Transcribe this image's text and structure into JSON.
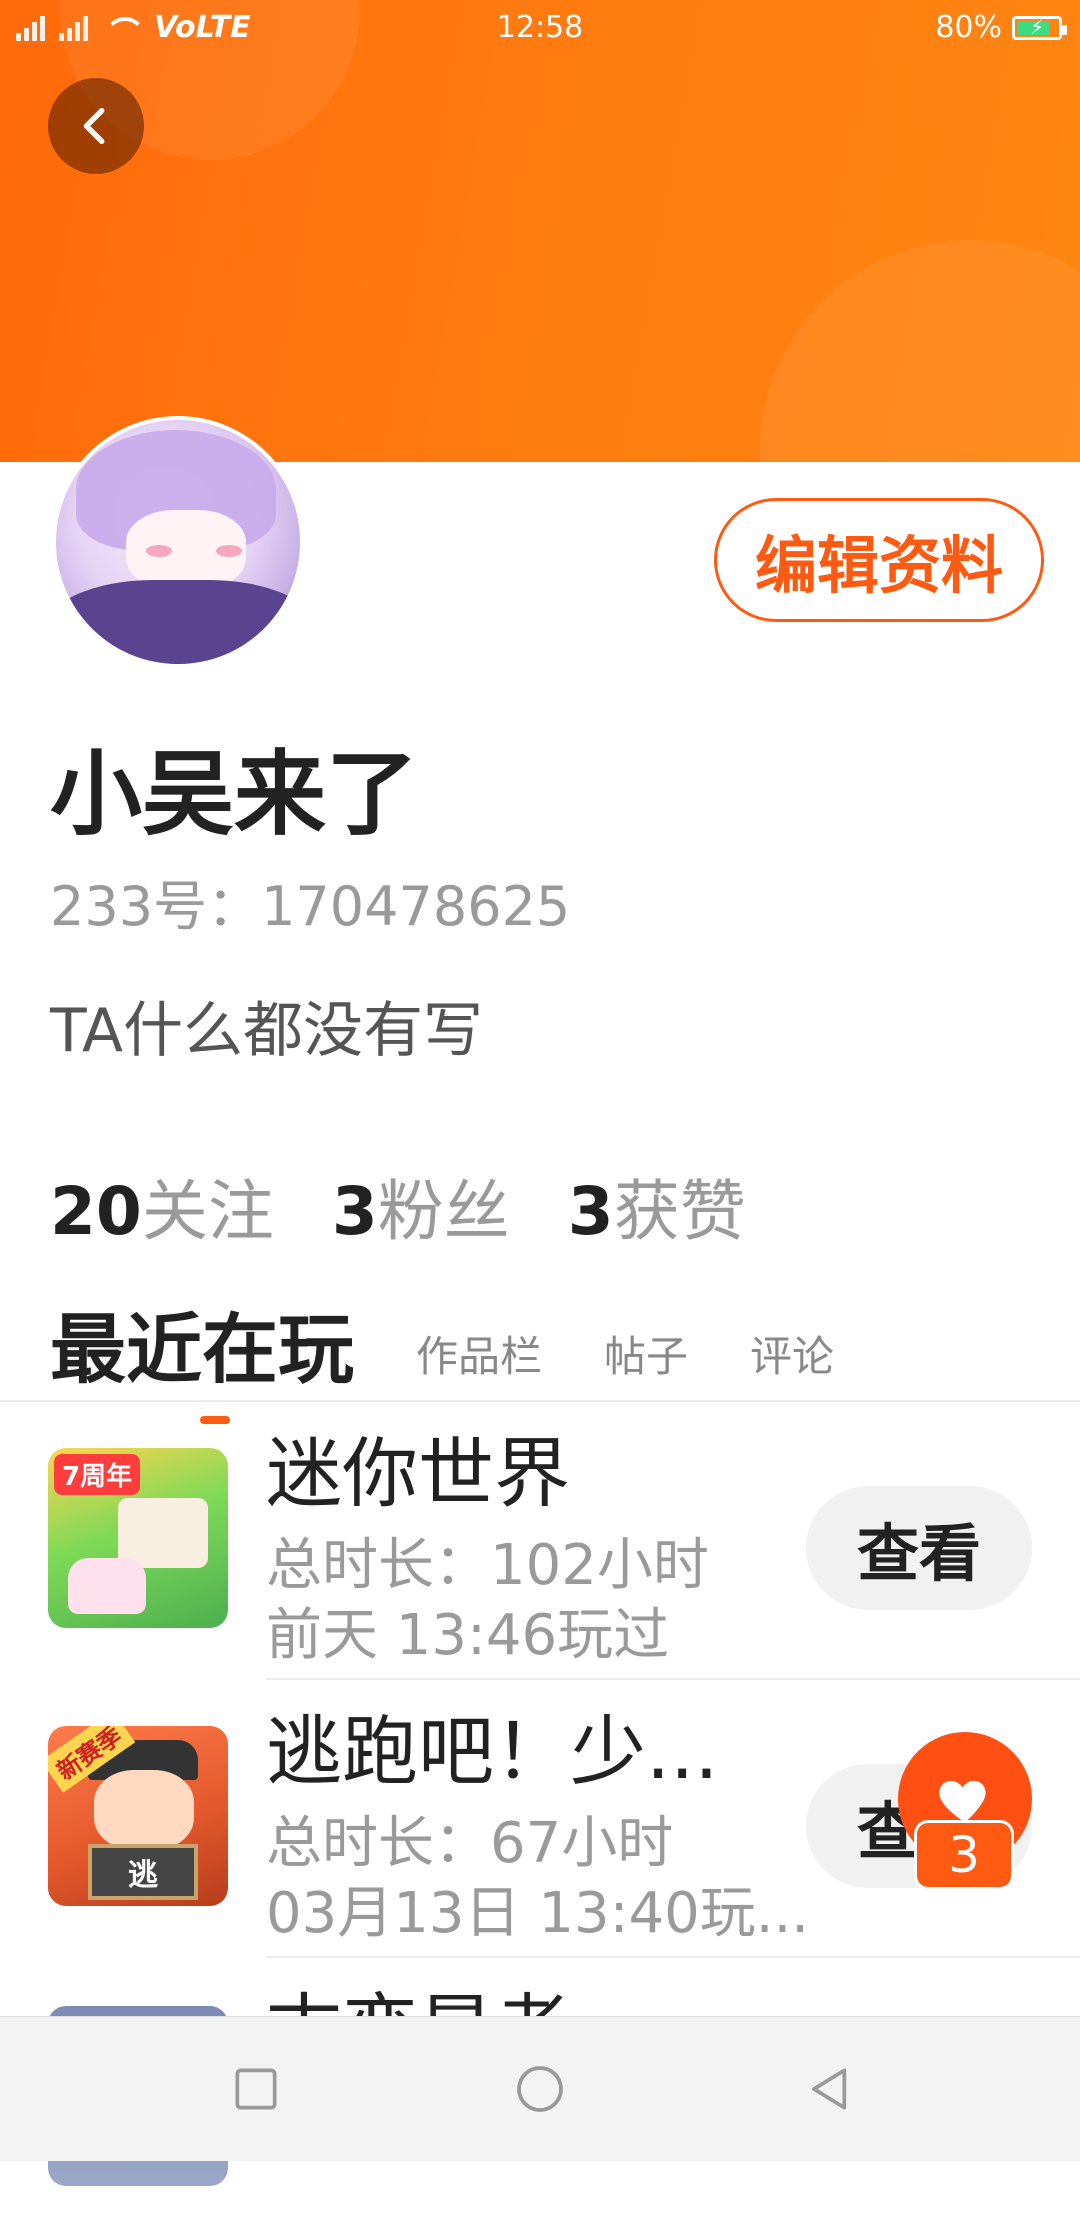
{
  "status_bar": {
    "network": "4G",
    "volte": "VoLTE",
    "time": "12:58",
    "battery": "80%",
    "battery_level": 0.8
  },
  "profile": {
    "username": "小吴来了",
    "account_id": "233号：170478625",
    "bio": "TA什么都没有写",
    "edit_button": "编辑资料"
  },
  "stats": [
    {
      "value": "20",
      "label": "关注"
    },
    {
      "value": "3",
      "label": "粉丝"
    },
    {
      "value": "3",
      "label": "获赞"
    }
  ],
  "tabs": {
    "active": "最近在玩",
    "others": [
      "作品栏",
      "帖子",
      "评论"
    ]
  },
  "games": [
    {
      "icon": "mini-world-icon",
      "icon_tag": "7周年",
      "title": "迷你世界",
      "total_time": "总时长：102小时",
      "last_played": "前天 13:46玩过",
      "button": "查看"
    },
    {
      "icon": "escape-boy-icon",
      "icon_tag": "新赛季",
      "icon_board": "逃",
      "title": "逃跑吧！少...",
      "total_time": "总时长：67小时",
      "last_played": "03月13日 13:40玩...",
      "button": "查看"
    },
    {
      "icon": "third-game-icon",
      "title": "古恋是者"
    }
  ],
  "fab": {
    "icon": "heart-icon",
    "count": "3"
  },
  "colors": {
    "accent": "#ff5a12",
    "banner": "#ff7a10"
  }
}
